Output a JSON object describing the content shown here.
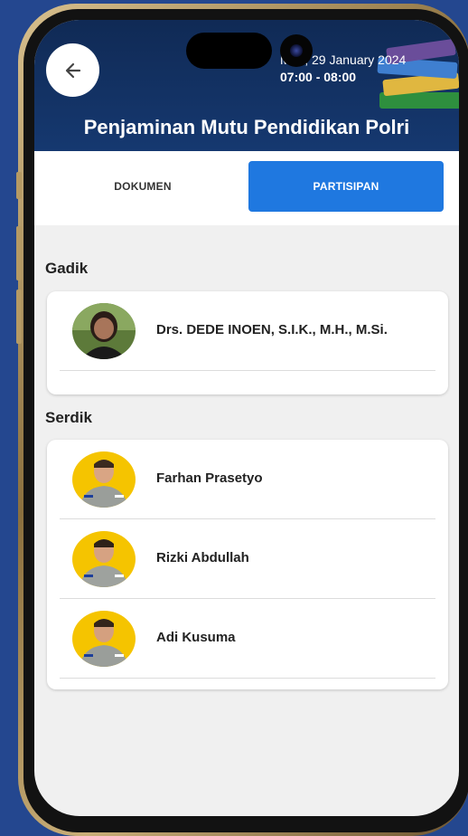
{
  "header": {
    "date": "Mon, 29 January 2024",
    "time": "07:00 - 08:00",
    "title": "Penjaminan Mutu Pendidikan Polri"
  },
  "tabs": [
    {
      "label": "DOKUMEN",
      "active": false
    },
    {
      "label": "PARTISIPAN",
      "active": true
    }
  ],
  "sections": [
    {
      "label": "Gadik",
      "participants": [
        {
          "name": "Drs. DEDE INOEN, S.I.K., M.H., M.Si."
        }
      ]
    },
    {
      "label": "Serdik",
      "participants": [
        {
          "name": "Farhan Prasetyo"
        },
        {
          "name": "Rizki Abdullah"
        },
        {
          "name": "Adi Kusuma"
        }
      ]
    }
  ],
  "colors": {
    "header": "#163a73",
    "accent": "#1f78e0",
    "background": "#24478f",
    "avatar_bg": "#f5c400"
  }
}
